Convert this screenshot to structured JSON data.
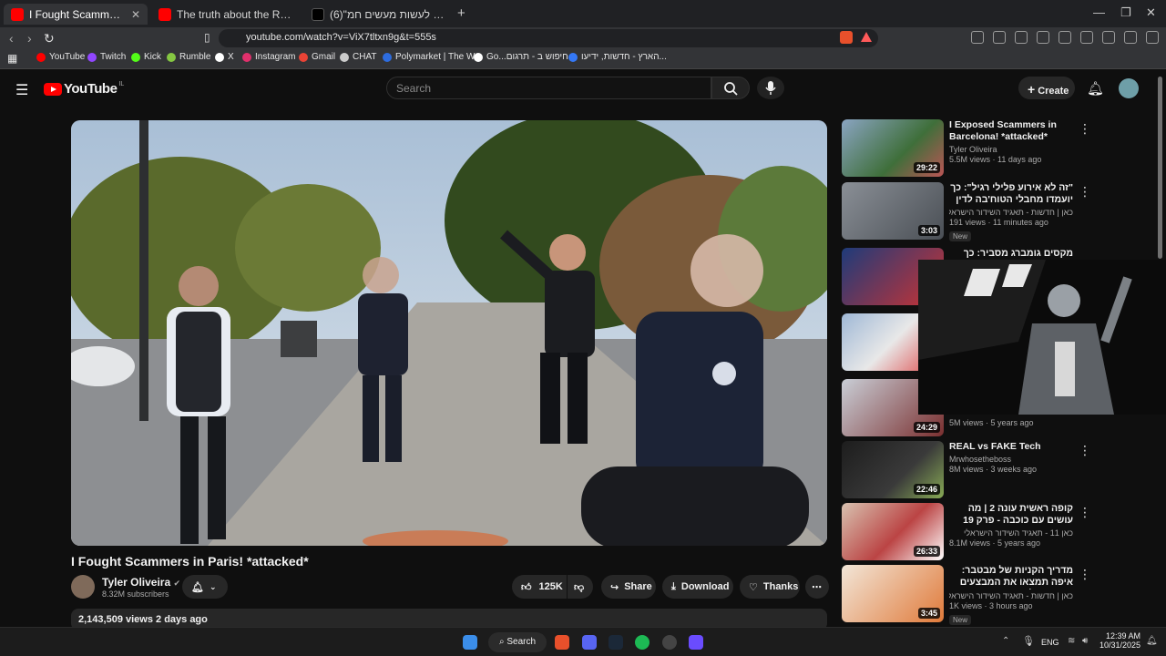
{
  "browser": {
    "tabs": [
      {
        "title": "I Fought Scammers in Paris! *a",
        "active": true
      },
      {
        "title": "The truth about the Roman salute #s",
        "active": false
      },
      {
        "title": "(6)\"בהחלט אפשר לעשות מעשים חמ",
        "active": false
      }
    ],
    "url": "youtube.com/watch?v=ViX7tltxn9g&t=555s",
    "bookmarks": [
      "YouTube",
      "Twitch",
      "Kick",
      "Rumble",
      "X",
      "Instagram",
      "Gmail",
      "CHAT",
      "Polymarket | The W...",
      "Go...חיפוש ב - תרגום",
      "הארץ - חדשות, ידיעו..."
    ]
  },
  "youtube": {
    "logo_text": "YouTube",
    "country_code": "IL",
    "search_placeholder": "Search",
    "create_label": "Create",
    "video": {
      "title": "I Fought Scammers in Paris! *attacked*",
      "channel": "Tyler Oliveira",
      "subscribers": "8.32M subscribers",
      "likes": "125K",
      "share": "Share",
      "download": "Download",
      "thanks": "Thanks",
      "views_date": "2,143,509 views  2 days ago"
    },
    "recommendations": [
      {
        "title": "I Exposed Scammers in Barcelona! *attacked*",
        "channel": "Tyler Oliveira",
        "meta": "5.5M views · 11 days ago",
        "duration": "29:22",
        "rtl": false
      },
      {
        "title": "\"זה לא אירוע פלילי רגיל\": כך יועמדו מחבלי הטוח'בה לדין",
        "channel": "כאן | חדשות - תאגיד השידור הישראלי",
        "meta": "191 views · 11 minutes ago",
        "duration": "3:03",
        "badge": "New",
        "rtl": true
      },
      {
        "title": "מקסים גומברג מסביר: כך תמתיעו",
        "channel": "",
        "meta": "",
        "duration": "",
        "rtl": true
      },
      {
        "title": "",
        "channel": "",
        "meta": "",
        "duration": "",
        "rtl": false
      },
      {
        "title": "",
        "channel": "",
        "meta": "5M views · 5 years ago",
        "duration": "24:29",
        "rtl": false
      },
      {
        "title": "REAL vs FAKE Tech",
        "channel": "Mrwhosetheboss",
        "meta": "8M views · 3 weeks ago",
        "duration": "22:46",
        "rtl": false
      },
      {
        "title": "קופה ראשית עונה 2 | מה עושים עם כוכבה - פרק 19",
        "channel": "כאן 11 - תאגיד השידור הישראלי",
        "meta": "8.1M views · 5 years ago",
        "duration": "26:33",
        "rtl": true
      },
      {
        "title": "מדריך הקניות של מבטבר: איפה תמצאו את המבצעים הכי משתלמים?",
        "channel": "כאן | חדשות - תאגיד השידור הישראלי",
        "meta": "1K views · 3 hours ago",
        "duration": "3:45",
        "badge": "New",
        "rtl": true
      }
    ]
  },
  "taskbar": {
    "search_label": "Search",
    "lang": "ENG",
    "time": "12:39 AM",
    "date": "10/31/2025"
  },
  "colors": {
    "accent": "#ff0000",
    "bg": "#0f0f0f",
    "pill": "#272727"
  }
}
